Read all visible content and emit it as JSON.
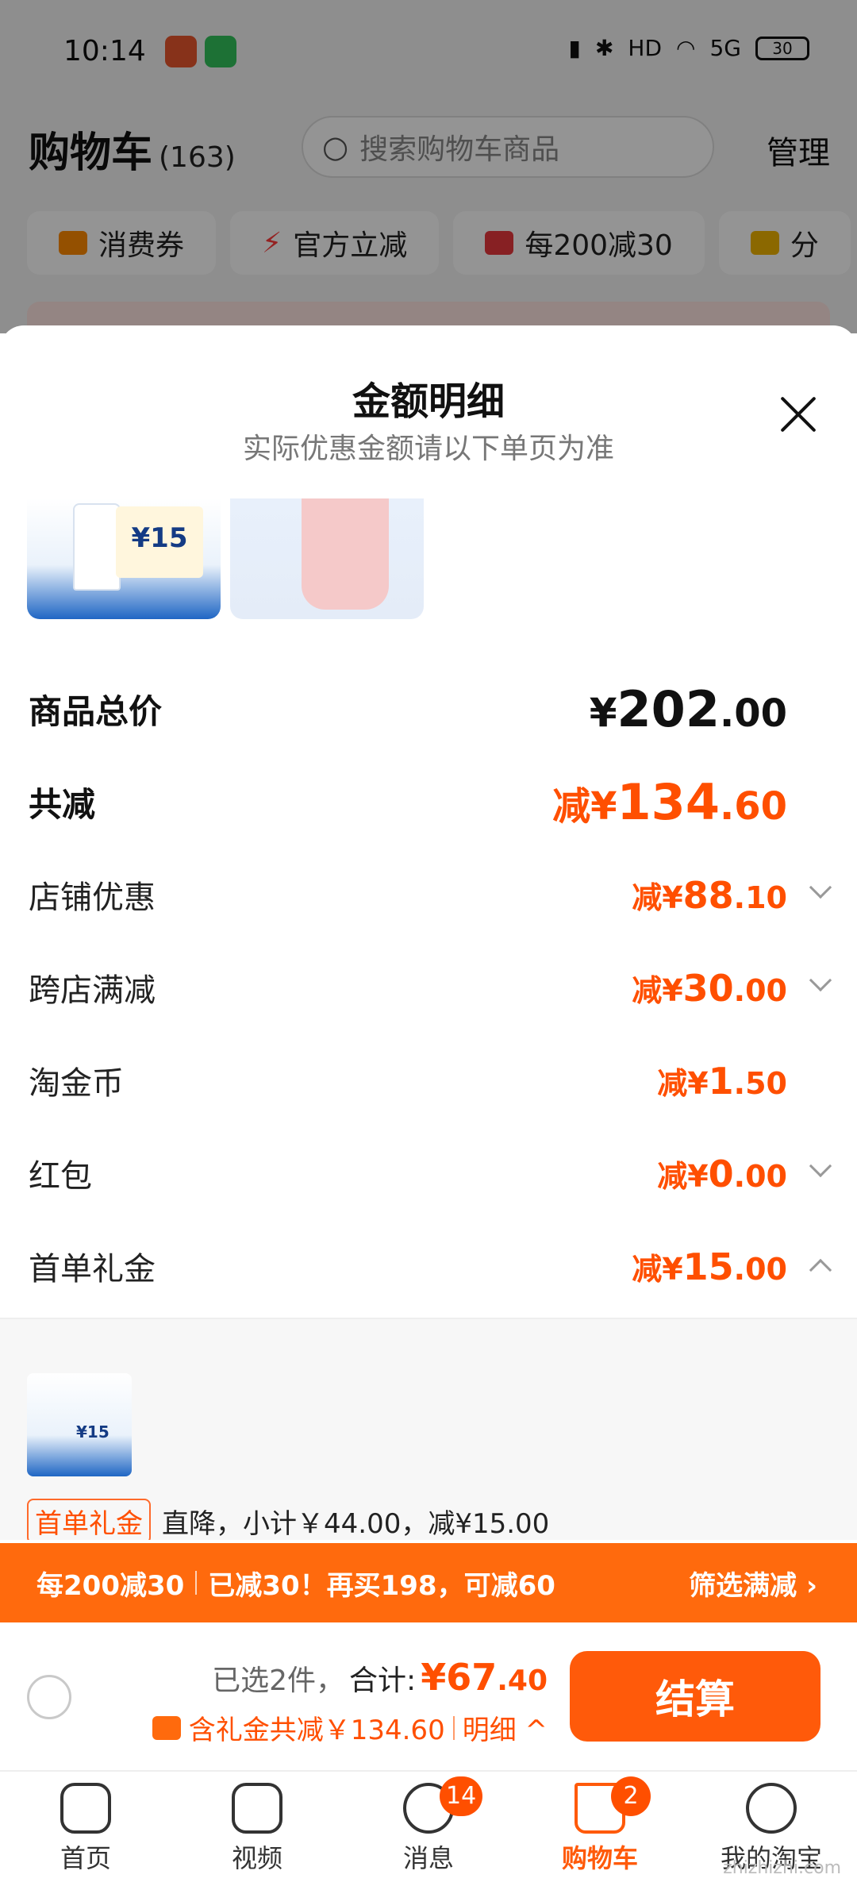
{
  "status_bar": {
    "time": "10:14",
    "network": "5G",
    "hd": "HD",
    "battery": "30"
  },
  "cart_header": {
    "title": "购物车",
    "count": "(163)",
    "search_placeholder": "搜索购物车商品",
    "manage": "管理"
  },
  "chips": [
    {
      "label": "消费券",
      "icon": "coupon-icon",
      "color": "#ff8a00"
    },
    {
      "label": "官方立减",
      "icon": "lightning-icon",
      "color": "#ff3b3b"
    },
    {
      "label": "每200减30",
      "icon": "store-icon",
      "color": "#e8383d"
    },
    {
      "label": "分",
      "icon": "folder-icon",
      "color": "#f0b400"
    }
  ],
  "sheet": {
    "title": "金额明细",
    "subtitle": "实际优惠金额请以下单页为准",
    "thumb1_price": "¥15",
    "rows": {
      "total_price": {
        "label": "商品总价",
        "prefix": "¥",
        "int": "202",
        "dec": ".00"
      },
      "total_discount": {
        "label": "共减",
        "prefix": "减¥",
        "int": "134",
        "dec": ".60"
      },
      "store": {
        "label": "店铺优惠",
        "prefix": "减¥",
        "int": "88",
        "dec": ".10"
      },
      "cross_store": {
        "label": "跨店满减",
        "prefix": "减¥",
        "int": "30",
        "dec": ".00"
      },
      "coins": {
        "label": "淘金币",
        "prefix": "减¥",
        "int": "1",
        "dec": ".50"
      },
      "red_packet": {
        "label": "红包",
        "prefix": "减¥",
        "int": "0",
        "dec": ".00"
      },
      "first_order": {
        "label": "首单礼金",
        "prefix": "减¥",
        "int": "15",
        "dec": ".00"
      }
    },
    "gift_panel": {
      "thumb_price": "¥15",
      "tag": "首单礼金",
      "text": "直降，小计￥44.00，减¥15.00"
    }
  },
  "promo_bar": {
    "part1": "每200减30",
    "part2": "已减30！再买198，可减60",
    "filter": "筛选满减 ›"
  },
  "summary": {
    "selected": "已选2件，",
    "total_label": "合计: ",
    "amount_int": "¥67",
    "amount_dec": ".40",
    "gift_text": "含礼金共减￥134.60",
    "detail": "明细 ^",
    "checkout": "结算"
  },
  "tabbar": [
    {
      "label": "首页",
      "icon": "home-icon"
    },
    {
      "label": "视频",
      "icon": "video-icon"
    },
    {
      "label": "消息",
      "icon": "message-icon",
      "badge": "14"
    },
    {
      "label": "购物车",
      "icon": "cart-icon",
      "badge": "2",
      "active": true
    },
    {
      "label": "我的淘宝",
      "icon": "profile-icon"
    }
  ],
  "colors": {
    "accent": "#ff4f00",
    "promo": "#ff6a0d",
    "checkout": "#ff5a0a"
  },
  "watermark": "zhizhizhi.com"
}
